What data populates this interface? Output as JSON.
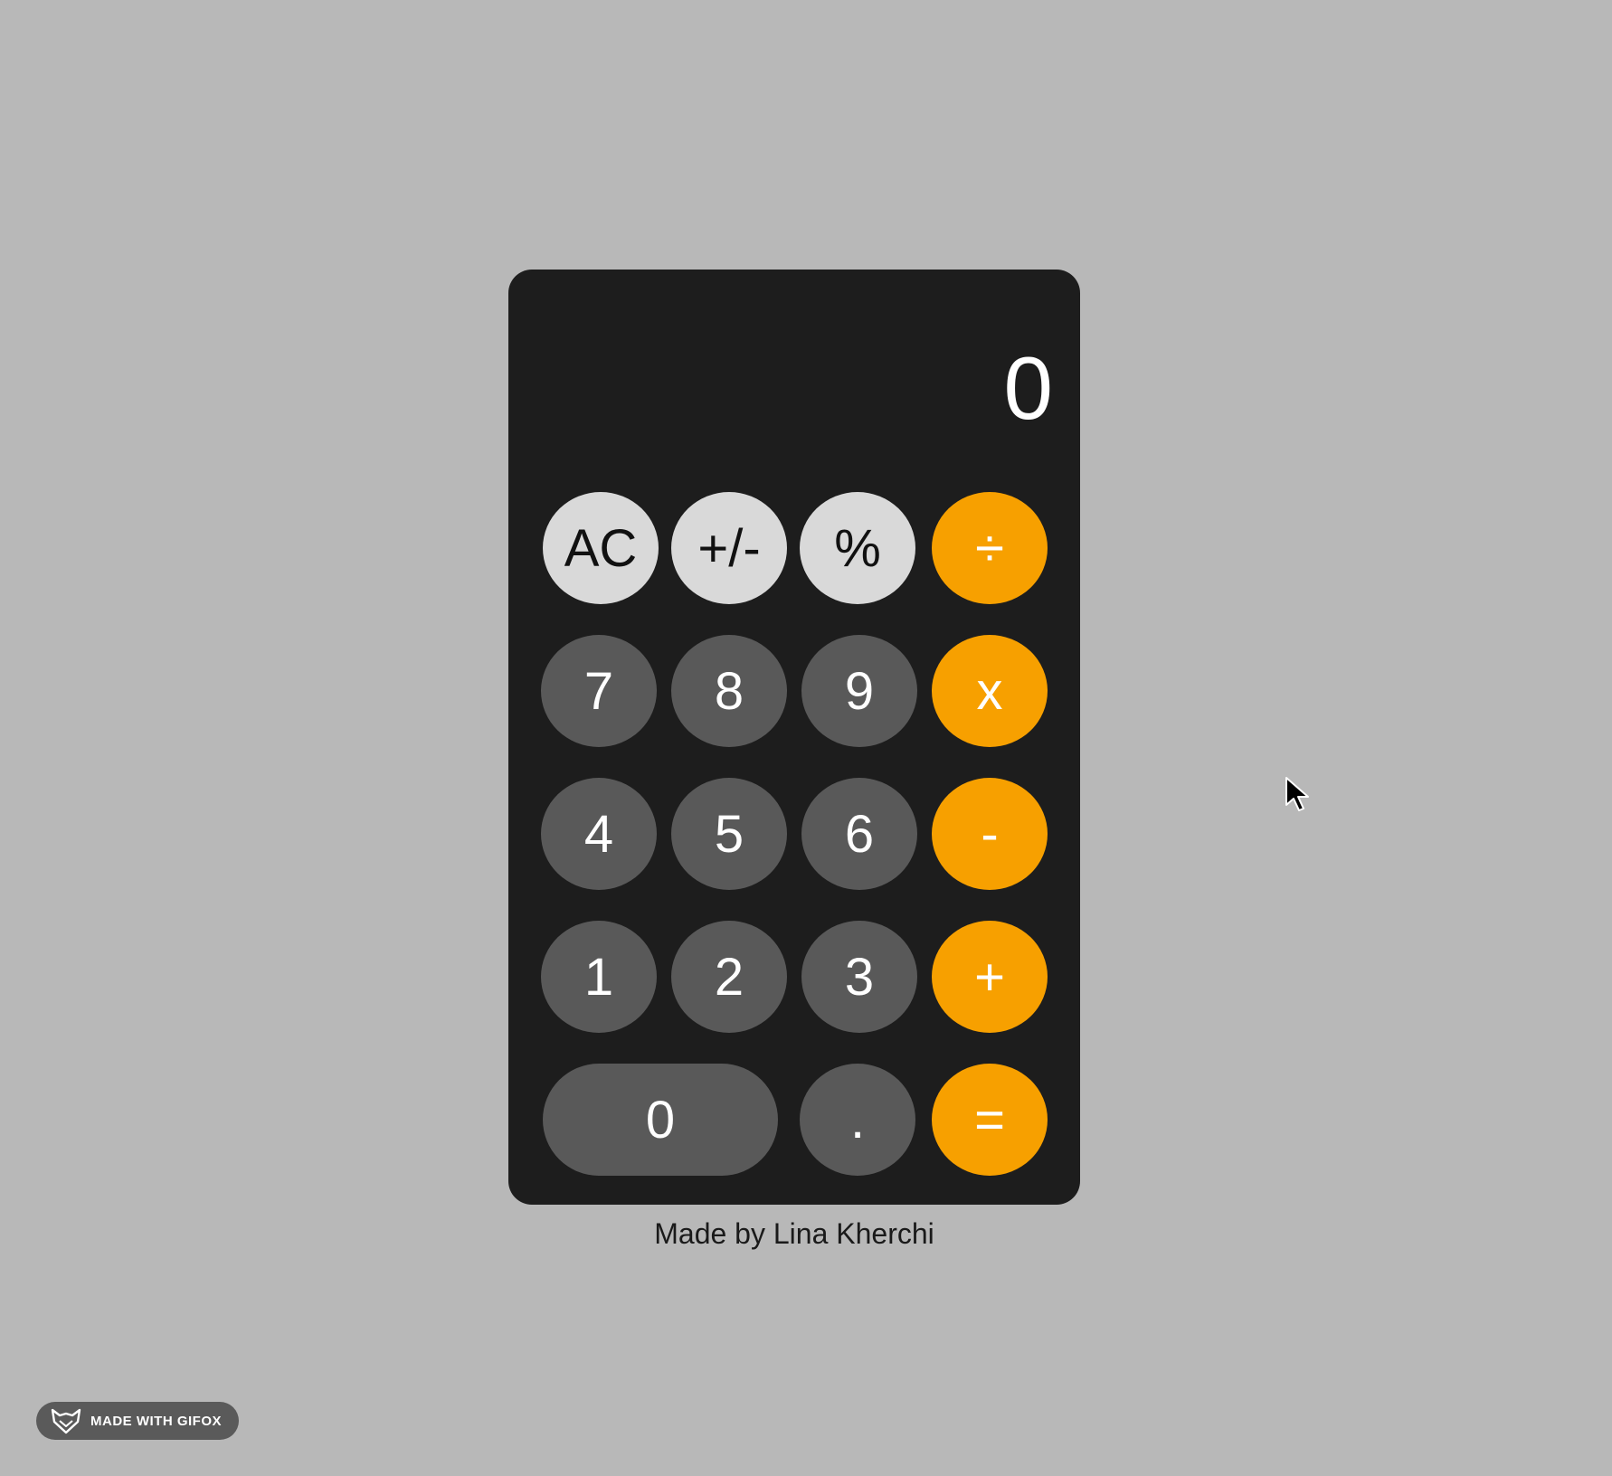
{
  "colors": {
    "background": "#b8b8b8",
    "calculator_body": "#1d1d1d",
    "function_key": "#d9d9d9",
    "number_key": "#595959",
    "operator_key": "#f7a000"
  },
  "display": {
    "value": "0"
  },
  "keys": {
    "ac": "AC",
    "sign": "+/-",
    "percent": "%",
    "divide": "÷",
    "seven": "7",
    "eight": "8",
    "nine": "9",
    "multiply": "x",
    "four": "4",
    "five": "5",
    "six": "6",
    "subtract": "-",
    "one": "1",
    "two": "2",
    "three": "3",
    "add": "+",
    "zero": "0",
    "decimal": ".",
    "equals": "="
  },
  "footer": {
    "credit": "Made by Lina Kherchi"
  },
  "badge": {
    "label": "MADE WITH GIFOX",
    "icon": "fox-icon"
  },
  "cursor": {
    "icon": "mouse-pointer-icon"
  }
}
